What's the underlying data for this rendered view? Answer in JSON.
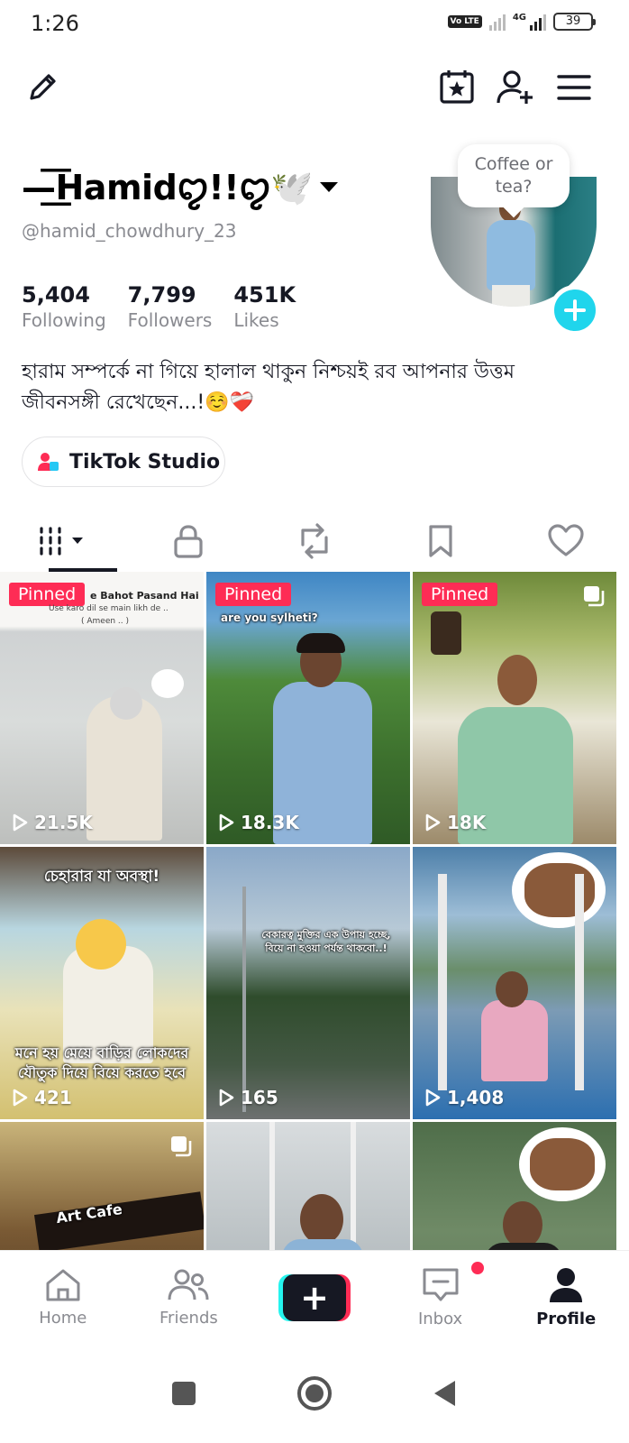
{
  "status_bar": {
    "time": "1:26",
    "volte": "Vo LTE",
    "network": "4G",
    "battery": "39"
  },
  "top_nav": {
    "edit_icon": "pencil-icon",
    "calendar_icon": "calendar-star-icon",
    "add_friend_icon": "add-user-icon",
    "menu_icon": "hamburger-menu-icon"
  },
  "profile": {
    "display_name": "—͟͞Hamidꨄ︎!!ꨄ︎🕊️",
    "username": "@hamid_chowdhury_23",
    "bubble_text": "Coffee or tea?",
    "bio": "হারাম সম্পর্কে না গিয়ে হালাল থাকুন নিশ্চয়ই রব আপনার উত্তম জীবনসঙ্গী রেখেছেন...!☺️❤️‍🩹"
  },
  "stats": [
    {
      "value": "5,404",
      "label": "Following"
    },
    {
      "value": "7,799",
      "label": "Followers"
    },
    {
      "value": "451K",
      "label": "Likes"
    }
  ],
  "studio_button": {
    "label": "TikTok Studio"
  },
  "tabs": [
    "videos",
    "private",
    "reposts",
    "favorites",
    "liked"
  ],
  "videos": [
    {
      "pinned": "Pinned",
      "views": "21.5K",
      "caption_top": "e Bahot Pasand Hai",
      "caption_sub": "Use karo dil se main likh de ..",
      "caption_sub2": "( Ameen .. )"
    },
    {
      "pinned": "Pinned",
      "views": "18.3K",
      "caption_top": "are you sylheti?"
    },
    {
      "pinned": "Pinned",
      "views": "18K"
    },
    {
      "views": "421",
      "caption_top": "চেহারার যা অবস্থা!",
      "caption_bottom": "মনে হয় মেয়ে বাড়ির লোকদের যৌতুক দিয়ে বিয়ে করতে হবে"
    },
    {
      "views": "165",
      "caption_mid": "বেকারত্ব মুক্তির এক উপায় হচ্ছে, বিয়ে না হওয়া পর্যন্ত থাকবো..!"
    },
    {
      "views": "1,408"
    },
    {
      "caption_top": "Art Cafe"
    },
    {},
    {}
  ],
  "bottom_nav": {
    "home": "Home",
    "friends": "Friends",
    "create": "+",
    "inbox": "Inbox",
    "profile": "Profile"
  },
  "colors": {
    "accent": "#fe2c55",
    "cyan": "#25f4ee",
    "add_button": "#20d5ec",
    "text": "#161823",
    "muted": "#8a8b91"
  }
}
